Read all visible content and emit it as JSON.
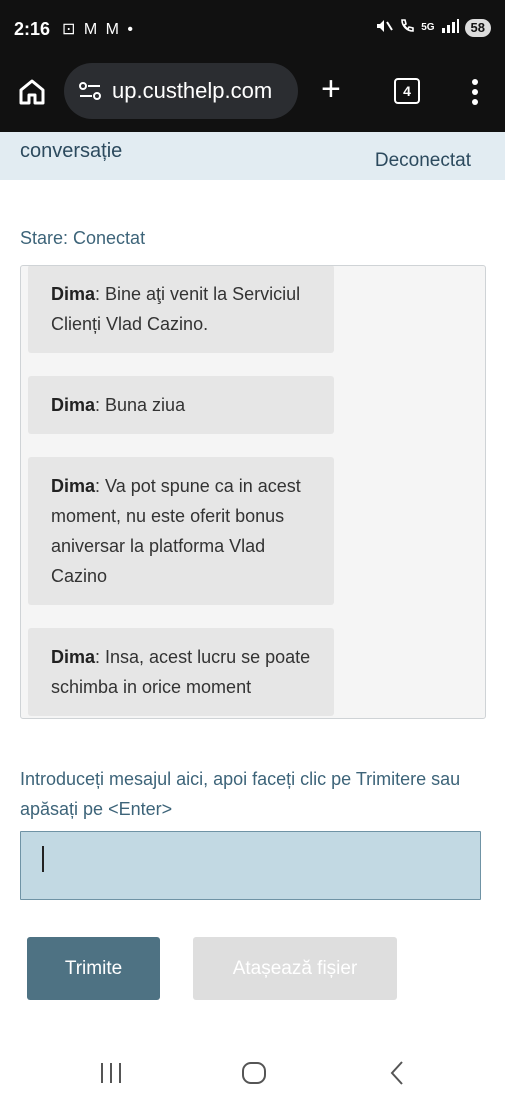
{
  "status_bar": {
    "time": "2:16",
    "notification_icons": "⊡ M M •",
    "network": "5G",
    "battery": "58"
  },
  "browser": {
    "url": "up.custhelp.com",
    "tab_count": "4"
  },
  "header": {
    "title": "conversație",
    "disconnect": "Deconectat"
  },
  "chat": {
    "status": "Stare: Conectat",
    "messages": [
      {
        "author": "Dima",
        "text": ": Bine aţi venit la Serviciul Clienți Vlad Cazino."
      },
      {
        "author": "Dima",
        "text": ": Buna ziua"
      },
      {
        "author": "Dima",
        "text": ": Va pot spune ca in acest moment, nu este oferit bonus aniversar la platforma Vlad Cazino"
      },
      {
        "author": "Dima",
        "text": ": Insa, acest lucru se poate schimba in orice moment"
      }
    ],
    "prompt": "Introduceți mesajul aici, apoi faceți clic pe Trimitere sau apăsați pe <Enter>",
    "input_value": ""
  },
  "buttons": {
    "send": "Trimite",
    "attach": "Atașează fișier"
  },
  "colors": {
    "header_bg": "#e2ecf2",
    "accent": "#4e7283",
    "input_bg": "#c2d9e3",
    "disabled": "#dedede"
  }
}
